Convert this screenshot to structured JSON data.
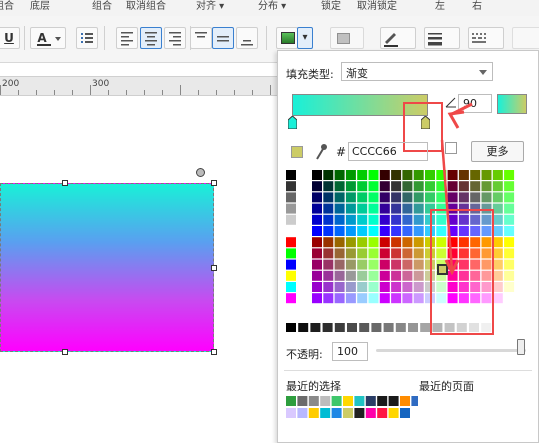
{
  "top_labels": [
    "组合",
    "底层",
    "组合",
    "取消组合",
    "对齐 ▾",
    "分布 ▾",
    "锁定",
    "取消锁定",
    "左",
    "右"
  ],
  "toolbar": {
    "underline_label": "U",
    "font_color_label": "A",
    "fill_arrow": "▾"
  },
  "ruler": {
    "marks": [
      "200",
      "300"
    ]
  },
  "fill_panel": {
    "fill_type_label": "填充类型:",
    "fill_type_value": "渐变",
    "angle_value": "90",
    "hash_label": "#",
    "hex_value": "CCCC66",
    "more_button": "更多",
    "opacity_label": "不透明:",
    "opacity_value": "100",
    "recent_selection_label": "最近的选择",
    "recent_pages_label": "最近的页面"
  },
  "colors": {
    "gradient_start": "#19f0d8",
    "gradient_end": "#cccc66",
    "selected_color": "#cccc66",
    "highlight": "#ef4848",
    "shape_top": "#19f0d8",
    "shape_bottom": "#ff00ff"
  },
  "icons": [
    "pen-icon",
    "line-icon",
    "dash-icon",
    "eyedropper-icon",
    "color-picker-icon",
    "align-center-icon",
    "list-icon"
  ]
}
